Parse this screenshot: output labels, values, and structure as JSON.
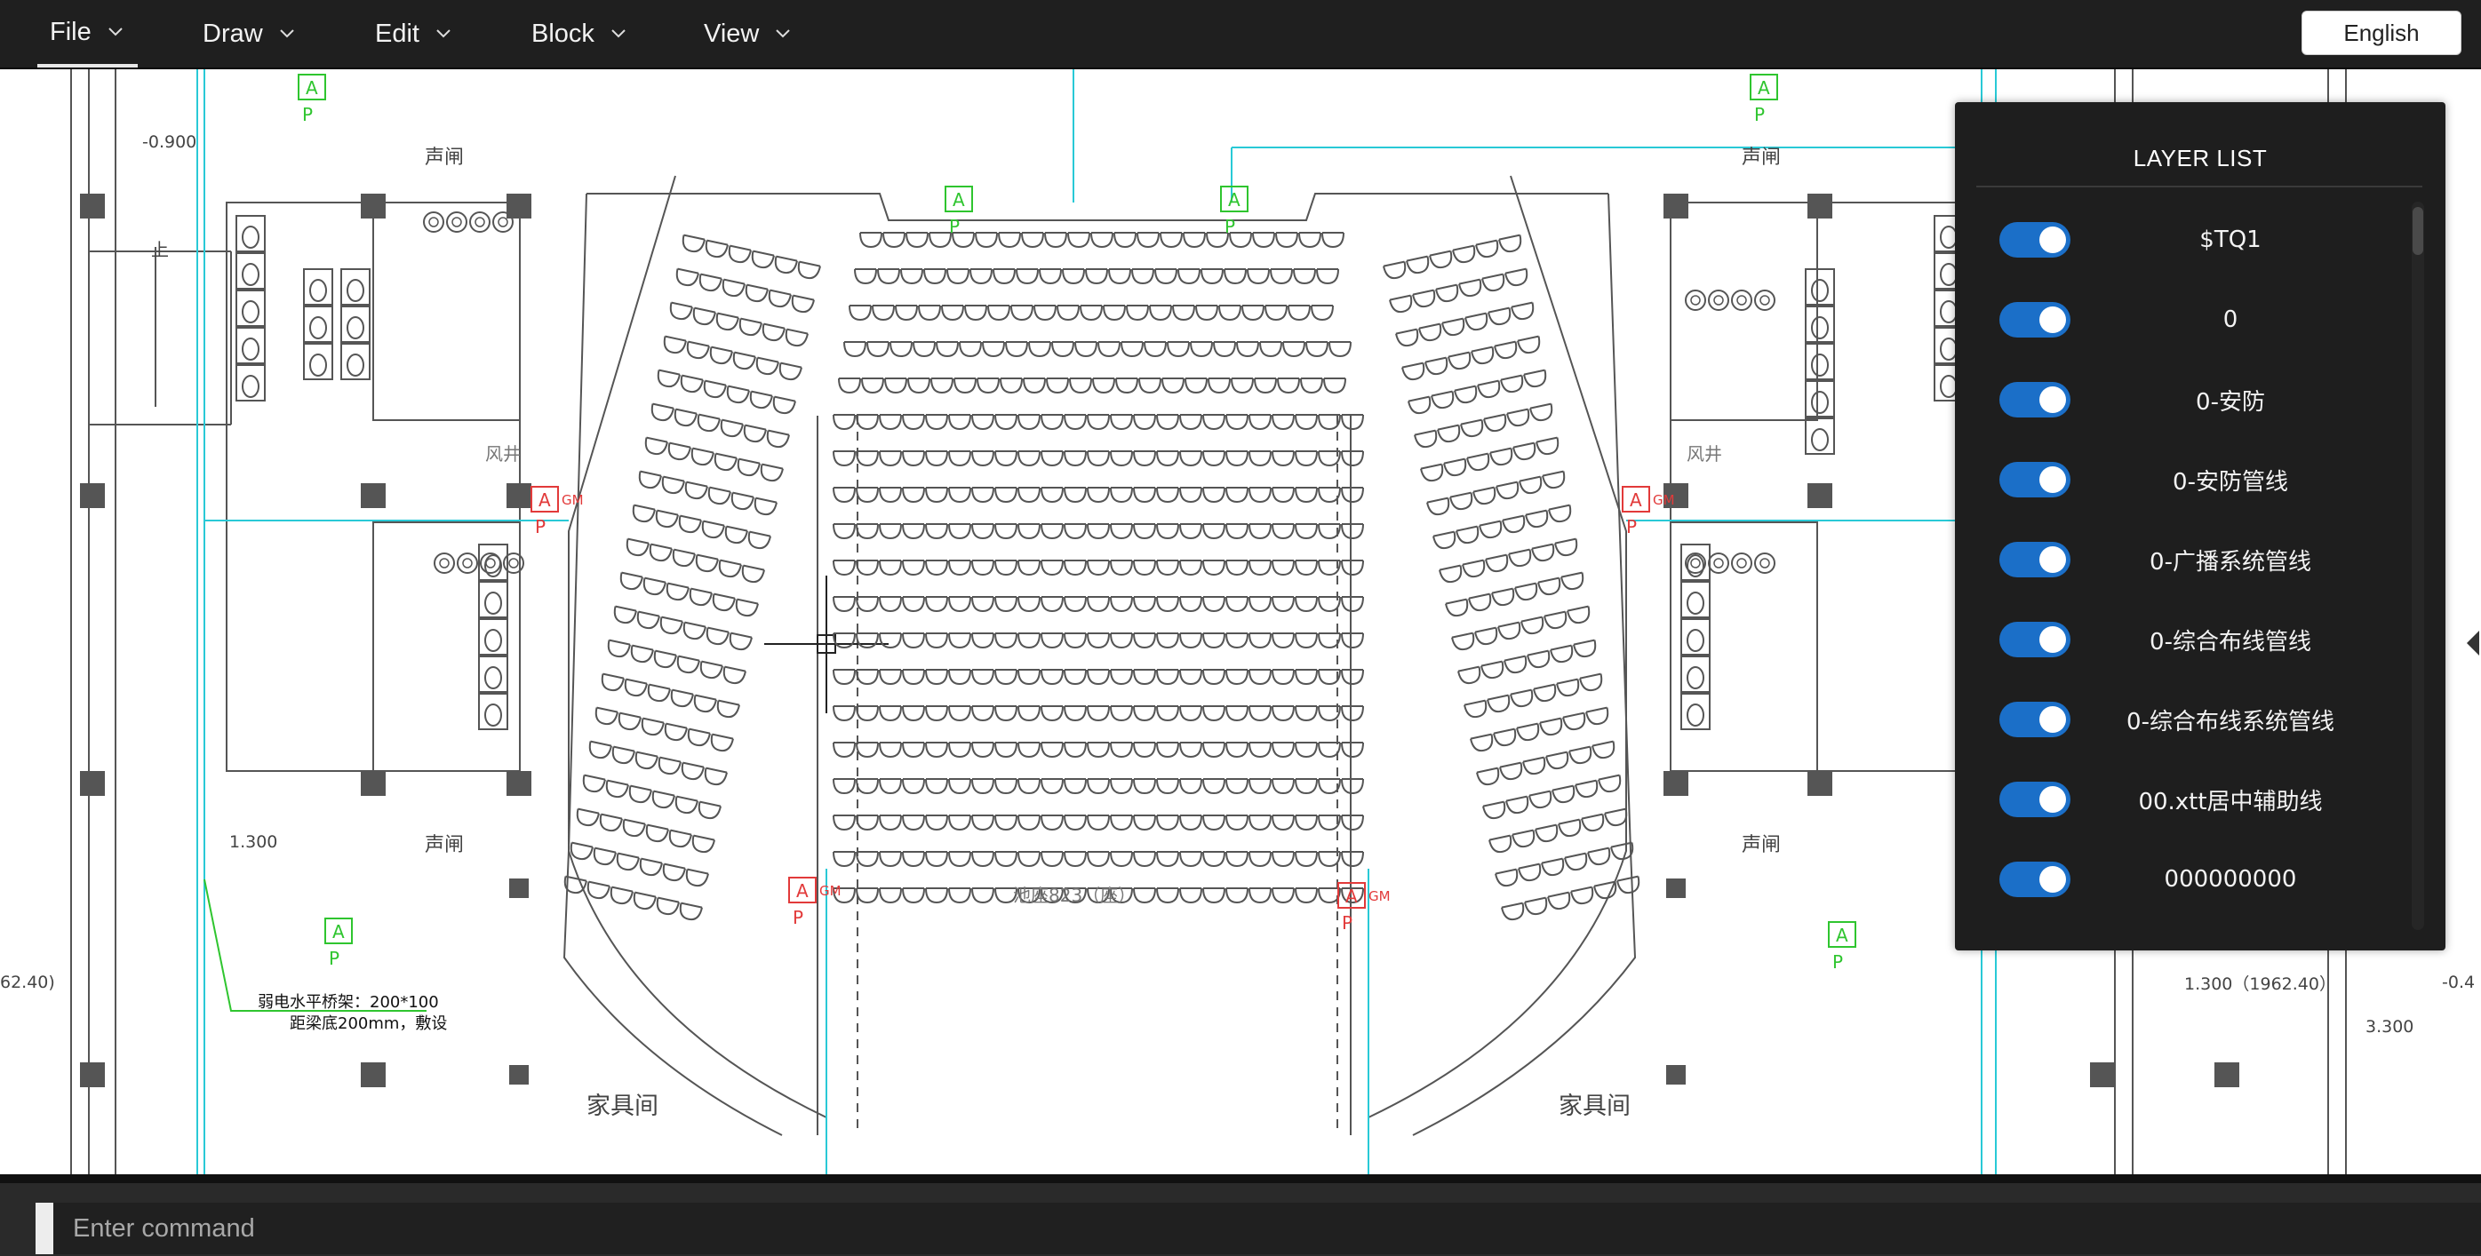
{
  "menu": {
    "items": [
      {
        "label": "File"
      },
      {
        "label": "Draw"
      },
      {
        "label": "Edit"
      },
      {
        "label": "Block"
      },
      {
        "label": "View"
      }
    ],
    "language": "English"
  },
  "drawing": {
    "labels": {
      "elev_top_left": "-0.900",
      "sound_lock": "声闸",
      "stairs_up": "上",
      "shaft": "风井",
      "elev_left": "1.300",
      "elev_left_far": "62.40)",
      "tray_note_1": "弱电水平桥架：200*100",
      "tray_note_2": "距梁底200mm，敷设",
      "furniture_room": "家具间",
      "stalls": "池座823（座）",
      "elev_right": "1.300（1962.40）",
      "elev_right_far": "3.300",
      "elev_right_edge": "-0.4",
      "tag_a": "A",
      "tag_p": "P",
      "tag_gm": "GM"
    },
    "colors": {
      "lines": "#555555",
      "cyan": "#29c9d6",
      "red": "#e23a3a",
      "green": "#2fc52f"
    }
  },
  "layer_panel": {
    "title": "LAYER LIST",
    "layers": [
      {
        "name": "$TQ1",
        "on": true
      },
      {
        "name": "0",
        "on": true
      },
      {
        "name": "0-安防",
        "on": true
      },
      {
        "name": "0-安防管线",
        "on": true
      },
      {
        "name": "0-广播系统管线",
        "on": true
      },
      {
        "name": "0-综合布线管线",
        "on": true
      },
      {
        "name": "0-综合布线系统管线",
        "on": true
      },
      {
        "name": "00.xtt居中辅助线",
        "on": true
      },
      {
        "name": "000000000",
        "on": true
      }
    ]
  },
  "command": {
    "placeholder": "Enter command"
  }
}
